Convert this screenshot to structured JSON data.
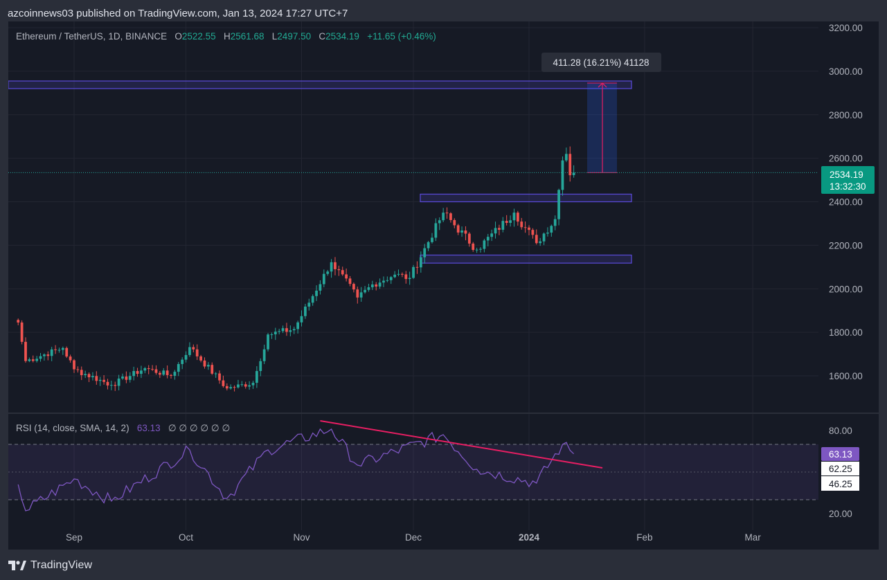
{
  "header": {
    "text": "azcoinnews03 published on TradingView.com, Jan 13, 2024 17:27 UTC+7"
  },
  "legend": {
    "symbol": "Ethereum / TetherUS, 1D, BINANCE",
    "o_label": "O",
    "o": "2522.55",
    "h_label": "H",
    "h": "2561.68",
    "l_label": "L",
    "l": "2497.50",
    "c_label": "C",
    "c": "2534.19",
    "change": "+11.65 (+0.46%)"
  },
  "measure_label": "411.28 (16.21%) 41128",
  "price_badge": {
    "price": "2534.19",
    "countdown": "13:32:30"
  },
  "price_axis": [
    "3200.00",
    "3000.00",
    "2800.00",
    "2600.00",
    "2400.00",
    "2200.00",
    "2000.00",
    "1800.00",
    "1600.00"
  ],
  "rsi": {
    "legend": "RSI (14, close, SMA, 14, 2)",
    "value": "63.13",
    "placeholders": "∅ ∅ ∅ ∅ ∅ ∅",
    "axis": [
      "80.00",
      "20.00"
    ],
    "badge_rsi": "63.13",
    "badge_upper": "62.25",
    "badge_lower": "46.25"
  },
  "time_axis": [
    "Sep",
    "Oct",
    "Nov",
    "Dec",
    "2024",
    "Feb",
    "Mar"
  ],
  "footer": {
    "brand": "TradingView"
  },
  "colors": {
    "up": "#26a69a",
    "down": "#ef5350",
    "rsi": "#7e57c2",
    "box": "#5b4bdb",
    "trend": "#e91e63"
  },
  "chart_data": {
    "type": "candlestick",
    "ylim": [
      1500,
      3220
    ],
    "zones": [
      {
        "low": 2920,
        "high": 2955
      },
      {
        "low": 2400,
        "high": 2435
      },
      {
        "low": 2118,
        "high": 2155
      }
    ],
    "measure": {
      "from": 2534.19,
      "to": 2945.47,
      "change": "411.28 (16.21%)",
      "ticks": "41128"
    },
    "anchors": [
      {
        "date": "Aug 17",
        "close": 1845
      },
      {
        "date": "Aug 19",
        "close": 1668
      },
      {
        "date": "Aug 29",
        "close": 1728
      },
      {
        "date": "Sep 1",
        "close": 1630
      },
      {
        "date": "Sep 11",
        "close": 1558
      },
      {
        "date": "Sep 20",
        "close": 1635
      },
      {
        "date": "Sep 27",
        "close": 1600
      },
      {
        "date": "Oct 2",
        "close": 1732
      },
      {
        "date": "Oct 12",
        "close": 1542
      },
      {
        "date": "Oct 19",
        "close": 1568
      },
      {
        "date": "Oct 23",
        "close": 1790
      },
      {
        "date": "Oct 30",
        "close": 1815
      },
      {
        "date": "Nov 9",
        "close": 2122
      },
      {
        "date": "Nov 16",
        "close": 1960
      },
      {
        "date": "Nov 20",
        "close": 2020
      },
      {
        "date": "Nov 26",
        "close": 2065
      },
      {
        "date": "Nov 30",
        "close": 2050
      },
      {
        "date": "Dec 9",
        "close": 2350
      },
      {
        "date": "Dec 18",
        "close": 2180
      },
      {
        "date": "Dec 28",
        "close": 2350
      },
      {
        "date": "Jan 3",
        "close": 2210
      },
      {
        "date": "Jan 8",
        "close": 2320
      },
      {
        "date": "Jan 10",
        "close": 2590
      },
      {
        "date": "Jan 11",
        "close": 2620
      },
      {
        "date": "Jan 12",
        "close": 2522
      },
      {
        "date": "Jan 13",
        "close": 2534.19
      }
    ],
    "rsi_anchors": [
      {
        "date": "Aug 17",
        "value": 41
      },
      {
        "date": "Aug 19",
        "value": 22
      },
      {
        "date": "Sep 1",
        "value": 45
      },
      {
        "date": "Sep 11",
        "value": 29
      },
      {
        "date": "Oct 2",
        "value": 66
      },
      {
        "date": "Oct 12",
        "value": 31
      },
      {
        "date": "Oct 23",
        "value": 66
      },
      {
        "date": "Nov 9",
        "value": 81
      },
      {
        "date": "Nov 16",
        "value": 55
      },
      {
        "date": "Dec 9",
        "value": 77
      },
      {
        "date": "Dec 18",
        "value": 52
      },
      {
        "date": "Jan 3",
        "value": 42
      },
      {
        "date": "Jan 10",
        "value": 70
      },
      {
        "date": "Jan 13",
        "value": 63.13
      }
    ],
    "rsi_levels": {
      "upper": 70,
      "lower": 30,
      "range": [
        0,
        100
      ]
    }
  }
}
